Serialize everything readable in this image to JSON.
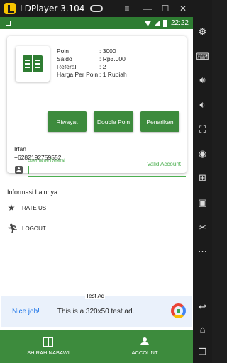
{
  "window": {
    "title": "LDPlayer 3.104",
    "buttons": {
      "menu": "≡",
      "minimize": "—",
      "maximize": "☐",
      "close": "✕"
    }
  },
  "statusbar": {
    "time": "22:22"
  },
  "profile": {
    "fields": [
      {
        "key": "Poin",
        "value": ": 3000"
      },
      {
        "key": "Saldo",
        "value": ": Rp3.000"
      },
      {
        "key": "Referal",
        "value": ": 2"
      },
      {
        "key": "Harga Per Poin",
        "value": ": 1 Rupiah"
      }
    ],
    "buttons": {
      "riwayat": "Riwayat",
      "double_poin": "Double Poin",
      "penarikan": "Penarikan"
    },
    "name": "Irfan",
    "phone": "+6282192759552",
    "status": "Valid Account"
  },
  "referral": {
    "label": "Username Referal",
    "value": ""
  },
  "more": {
    "title": "Informasi Lainnya",
    "items": [
      {
        "label": "RATE US",
        "icon": "star-icon"
      },
      {
        "label": "LOGOUT",
        "icon": "running-person-icon"
      }
    ]
  },
  "ad": {
    "label": "Test Ad",
    "headline": "Nice job!",
    "body": "This is a 320x50 test ad."
  },
  "bottom_nav": {
    "items": [
      {
        "label": "SHIRAH NABAWI"
      },
      {
        "label": "ACCOUNT"
      }
    ]
  },
  "colors": {
    "primary": "#3d8b3d",
    "statusbar": "#2e7d32",
    "accent": "#4caf50",
    "link": "#1a73e8"
  },
  "sidebar": {
    "icons": [
      "gear-icon",
      "keyboard-icon",
      "volume-up-icon",
      "volume-down-icon",
      "fullscreen-icon",
      "record-icon",
      "add-app-icon",
      "apk-icon",
      "scissors-icon",
      "more-icon",
      "back-icon",
      "home-icon",
      "recent-apps-icon"
    ]
  }
}
